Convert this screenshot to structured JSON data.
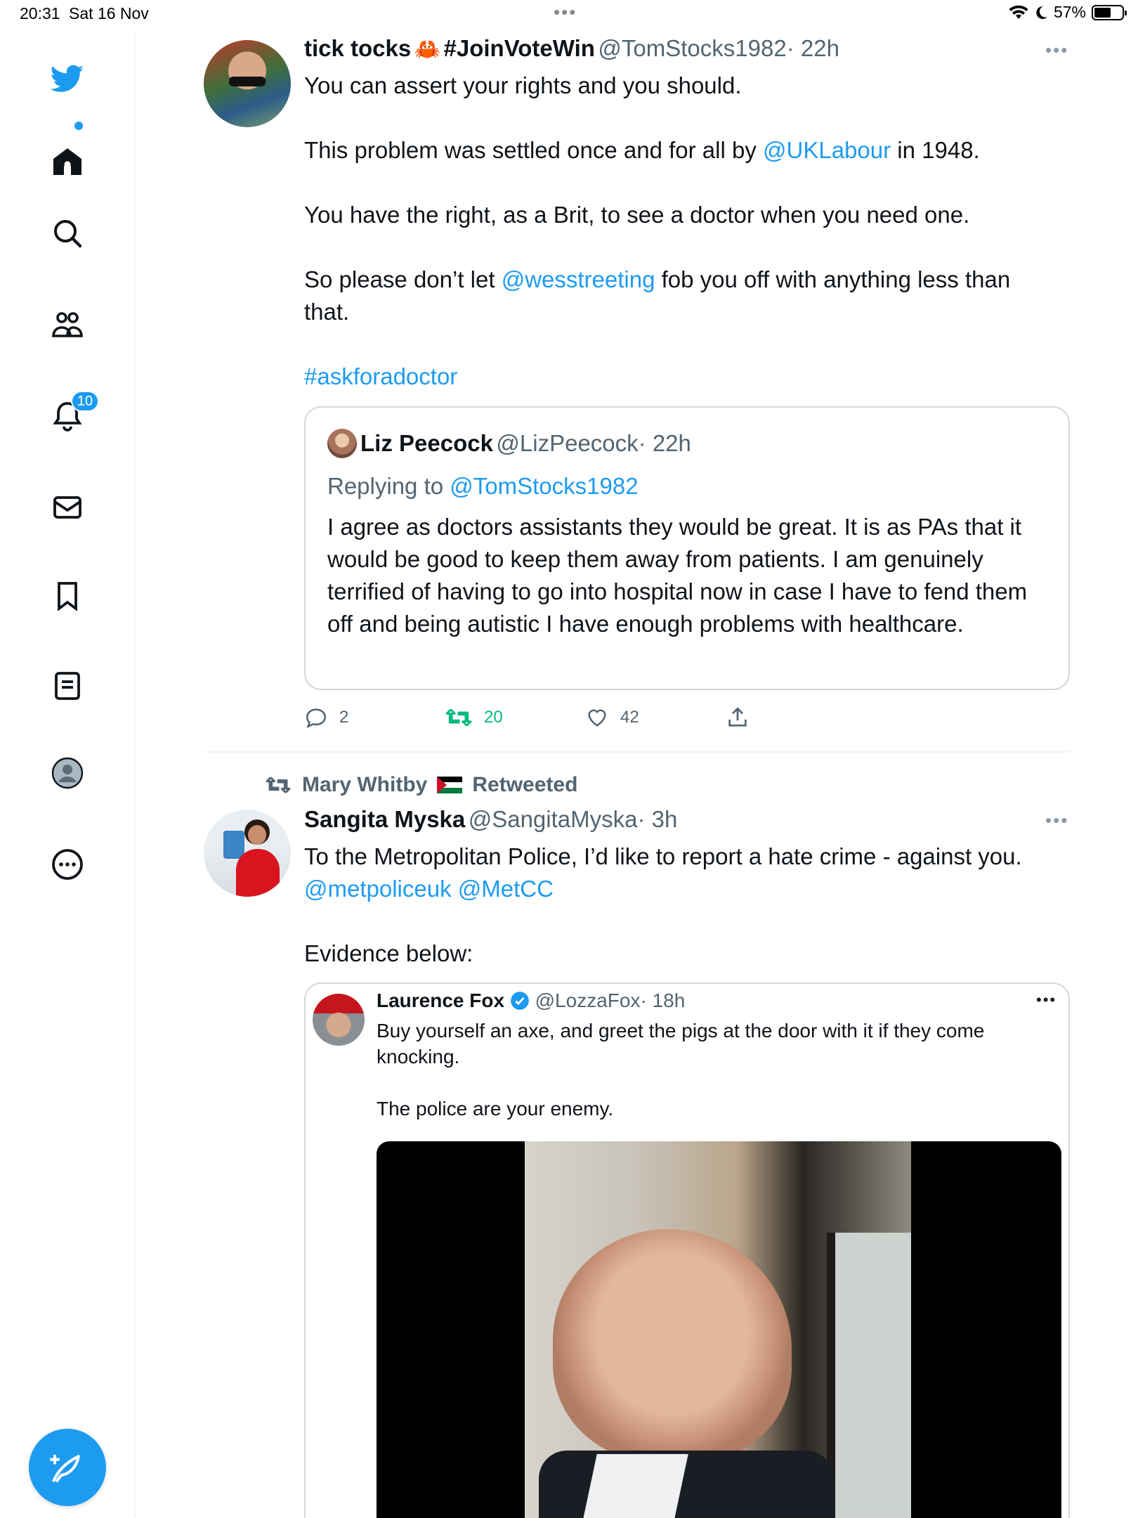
{
  "status_bar": {
    "time": "20:31",
    "date": "Sat 16 Nov",
    "battery": "57%"
  },
  "sidebar": {
    "notification_count": "10"
  },
  "tweet1": {
    "name": "tick tocks",
    "name_emoji": "🦀",
    "name_tag": "#JoinVoteWin",
    "handle": "@TomStocks1982",
    "time": "· 22h",
    "line1": "You can assert your rights and you should.",
    "line2_pre": "This problem was settled once and for all by ",
    "line2_link": "@UKLabour",
    "line2_post": " in 1948.",
    "line3": "You have the right, as a Brit, to see a doctor when you need one.",
    "line4_pre": "So please don’t let ",
    "line4_link": "@wesstreeting",
    "line4_post": "  fob you off with anything less than",
    "line4_cont": "that.",
    "hashtag": "#askforadoctor",
    "quote": {
      "name": "Liz Peecock",
      "handle": "@LizPeecock",
      "time": "· 22h",
      "replying_label": "Replying to ",
      "replying_handle": "@TomStocks1982",
      "text": "I agree as doctors assistants they would be great. It is as PAs that it would be good to keep them away from patients.  I am genuinely terrified of having to go into hospital now in case I have to fend them off and being autistic I have enough problems with healthcare."
    },
    "replies": "2",
    "retweets": "20",
    "likes": "42"
  },
  "tweet2": {
    "retweeted_by": "Mary Whitby",
    "retweeted_label": "Retweeted",
    "name": "Sangita Myska",
    "handle": "@SangitaMyska",
    "time": "· 3h",
    "line1": "To the Metropolitan Police, I’d like to report a hate crime - against you.",
    "link1": "@metpoliceuk",
    "link2": "@MetCC",
    "line3": "Evidence below:",
    "quote": {
      "name": "Laurence Fox",
      "handle": "@LozzaFox",
      "time": "· 18h",
      "line1": "Buy yourself an axe, and greet the pigs at the door with it if they come",
      "line2": "knocking.",
      "line3": "The police are your enemy."
    }
  },
  "colors": {
    "accent": "#1d9bf0",
    "retweet_green": "#00ba7c",
    "text": "#0f1419",
    "secondary": "#536471"
  }
}
